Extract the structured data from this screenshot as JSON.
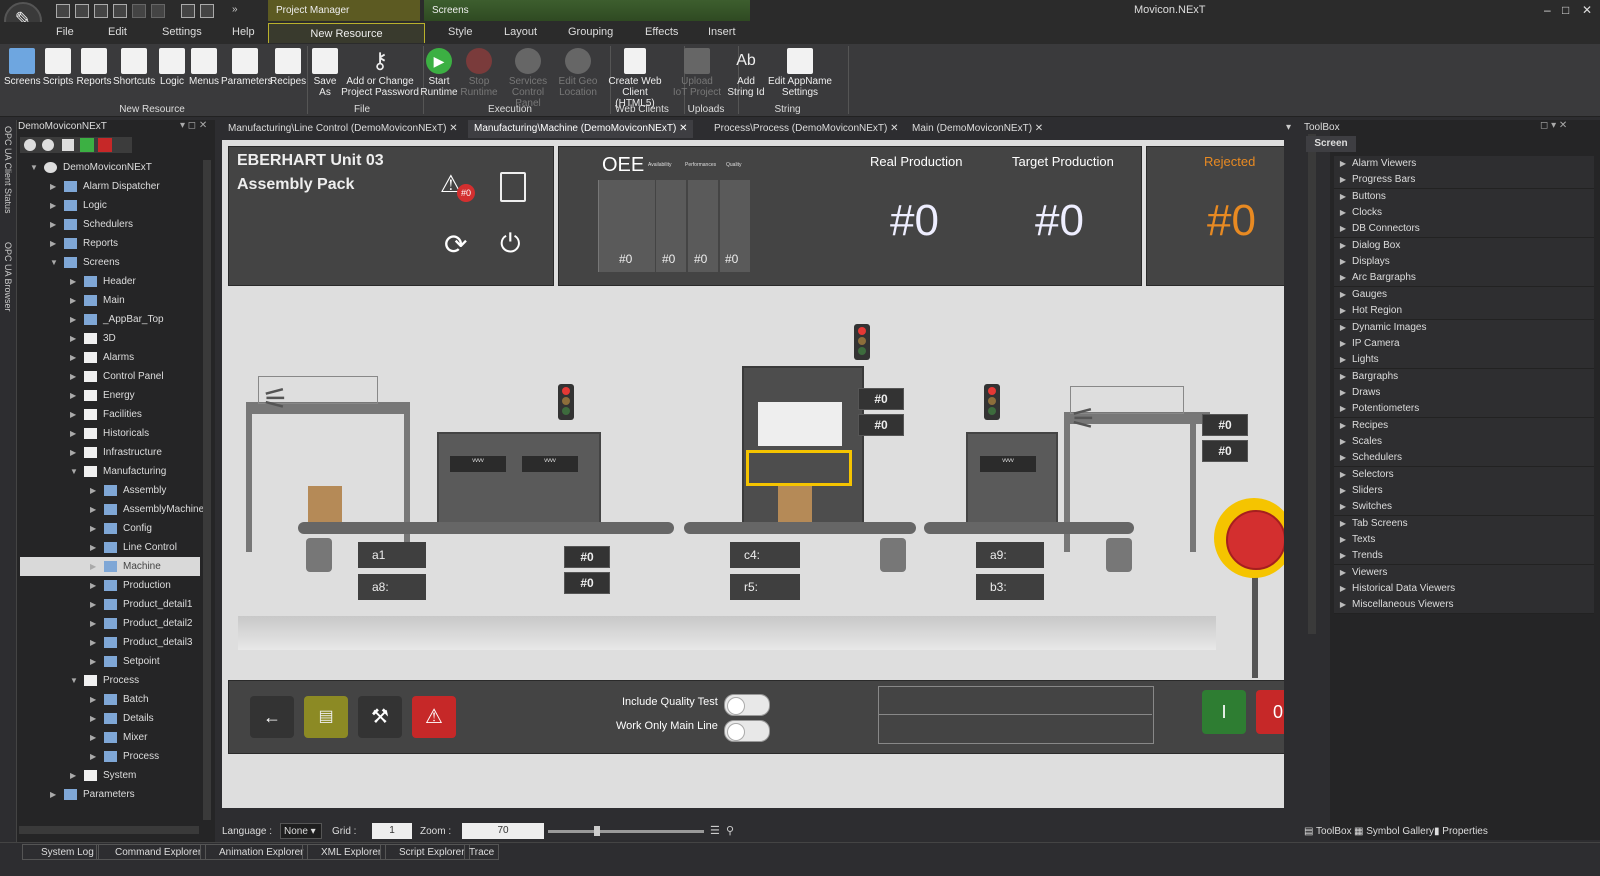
{
  "app": {
    "title": "Movicon.NExT",
    "ctx_project": "Project Manager",
    "ctx_screens": "Screens",
    "win_min": "–",
    "win_max": "□",
    "win_close": "✕"
  },
  "menu": {
    "file": "File",
    "edit": "Edit",
    "settings": "Settings",
    "help": "Help",
    "new_resource": "New Resource",
    "style": "Style",
    "layout": "Layout",
    "grouping": "Grouping",
    "effects": "Effects",
    "insert": "Insert"
  },
  "ribbon": {
    "screens": "Screens",
    "scripts": "Scripts",
    "reports": "Reports",
    "shortcuts": "Shortcuts",
    "logic": "Logic",
    "menus": "Menus",
    "parameters": "Parameters",
    "recipes": "Recipes",
    "save_as_1": "Save",
    "save_as_2": "As",
    "pwd_1": "Add or Change",
    "pwd_2": "Project Password",
    "start_1": "Start",
    "start_2": "Runtime",
    "stop_1": "Stop",
    "stop_2": "Runtime",
    "svc_1": "Services",
    "svc_2": "Control Panel",
    "geo_1": "Edit Geo",
    "geo_2": "Location",
    "web_1": "Create Web",
    "web_2": "Client (HTML5)",
    "upload_1": "Upload",
    "upload_2": "IoT Project",
    "addstr_1": "Add",
    "addstr_2": "String Id",
    "appname_1": "Edit AppName",
    "appname_2": "Settings",
    "g_newres": "New Resource",
    "g_file": "File",
    "g_exec": "Execution",
    "g_web": "Web Clients",
    "g_uploads": "Uploads",
    "g_string": "String"
  },
  "left": {
    "title": "DemoMoviconNExT",
    "strip1": "OPC UA Client Status",
    "strip2": "OPC UA Browser"
  },
  "tree": [
    {
      "label": "DemoMoviconNExT",
      "indent": 0,
      "icon": "gear",
      "arrow": "▼"
    },
    {
      "label": "Alarm Dispatcher",
      "indent": 1,
      "icon": "file",
      "arrow": "▶"
    },
    {
      "label": "Logic",
      "indent": 1,
      "icon": "file",
      "arrow": "▶"
    },
    {
      "label": "Schedulers",
      "indent": 1,
      "icon": "file",
      "arrow": "▶"
    },
    {
      "label": "Reports",
      "indent": 1,
      "icon": "file",
      "arrow": "▶"
    },
    {
      "label": "Screens",
      "indent": 1,
      "icon": "file",
      "arrow": "▼"
    },
    {
      "label": "Header",
      "indent": 2,
      "icon": "file",
      "arrow": "▶"
    },
    {
      "label": "Main",
      "indent": 2,
      "icon": "file",
      "arrow": "▶"
    },
    {
      "label": "_AppBar_Top",
      "indent": 2,
      "icon": "file",
      "arrow": "▶"
    },
    {
      "label": "3D",
      "indent": 2,
      "icon": "folder",
      "arrow": "▶"
    },
    {
      "label": "Alarms",
      "indent": 2,
      "icon": "folder",
      "arrow": "▶"
    },
    {
      "label": "Control Panel",
      "indent": 2,
      "icon": "folder",
      "arrow": "▶"
    },
    {
      "label": "Energy",
      "indent": 2,
      "icon": "folder",
      "arrow": "▶"
    },
    {
      "label": "Facilities",
      "indent": 2,
      "icon": "folder",
      "arrow": "▶"
    },
    {
      "label": "Historicals",
      "indent": 2,
      "icon": "folder",
      "arrow": "▶"
    },
    {
      "label": "Infrastructure",
      "indent": 2,
      "icon": "folder",
      "arrow": "▶"
    },
    {
      "label": "Manufacturing",
      "indent": 2,
      "icon": "folder",
      "arrow": "▼"
    },
    {
      "label": "Assembly",
      "indent": 3,
      "icon": "file",
      "arrow": "▶"
    },
    {
      "label": "AssemblyMachine",
      "indent": 3,
      "icon": "file",
      "arrow": "▶"
    },
    {
      "label": "Config",
      "indent": 3,
      "icon": "file",
      "arrow": "▶"
    },
    {
      "label": "Line Control",
      "indent": 3,
      "icon": "file",
      "arrow": "▶"
    },
    {
      "label": "Machine",
      "indent": 3,
      "icon": "file",
      "arrow": "▶",
      "selected": true
    },
    {
      "label": "Production",
      "indent": 3,
      "icon": "file",
      "arrow": "▶"
    },
    {
      "label": "Product_detail1",
      "indent": 3,
      "icon": "file",
      "arrow": "▶"
    },
    {
      "label": "Product_detail2",
      "indent": 3,
      "icon": "file",
      "arrow": "▶"
    },
    {
      "label": "Product_detail3",
      "indent": 3,
      "icon": "file",
      "arrow": "▶"
    },
    {
      "label": "Setpoint",
      "indent": 3,
      "icon": "file",
      "arrow": "▶"
    },
    {
      "label": "Process",
      "indent": 2,
      "icon": "folder",
      "arrow": "▼"
    },
    {
      "label": "Batch",
      "indent": 3,
      "icon": "file",
      "arrow": "▶"
    },
    {
      "label": "Details",
      "indent": 3,
      "icon": "file",
      "arrow": "▶"
    },
    {
      "label": "Mixer",
      "indent": 3,
      "icon": "file",
      "arrow": "▶"
    },
    {
      "label": "Process",
      "indent": 3,
      "icon": "file",
      "arrow": "▶"
    },
    {
      "label": "System",
      "indent": 2,
      "icon": "folder",
      "arrow": "▶"
    },
    {
      "label": "Parameters",
      "indent": 1,
      "icon": "file",
      "arrow": "▶"
    }
  ],
  "tabs": [
    "Manufacturing\\Line Control (DemoMoviconNExT)",
    "Manufacturing\\Machine (DemoMoviconNExT)",
    "Process\\Process (DemoMoviconNExT)",
    "Main (DemoMoviconNExT)"
  ],
  "screen": {
    "title1": "EBERHART  Unit 03",
    "title2": "Assembly Pack",
    "alarm_badge": "#0",
    "oee": "OEE",
    "oee_avail": "Availability",
    "oee_perf": "Performances",
    "oee_qual": "Quality",
    "oee_vals": [
      "#0",
      "#0",
      "#0",
      "#0"
    ],
    "real_prod": "Real Production",
    "target_prod": "Target Production",
    "rejected": "Rejected",
    "real_val": "#0",
    "target_val": "#0",
    "rejected_val": "#0",
    "tags": [
      "#0",
      "#0",
      "#0",
      "#0",
      "#0",
      "#0",
      "#0",
      "#0"
    ],
    "a1": "a1",
    "a8": "a8:",
    "c4": "c4:",
    "r5": "r5:",
    "a9": "a9:",
    "b3": "b3:",
    "quality_test": "Include Quality Test",
    "main_line": "Work Only Main Line",
    "start": "I",
    "stop": "0",
    "rejected_color": "#e88a22"
  },
  "status": {
    "language": "Language :",
    "language_val": "None",
    "grid": "Grid :",
    "grid_val": "1",
    "zoom": "Zoom :",
    "zoom_val": "70"
  },
  "bottom": [
    "System Log",
    "Command Explorer",
    "Animation Explorer",
    "XML Explorer",
    "Script Explorer",
    "Trace"
  ],
  "toolbox": {
    "title": "ToolBox",
    "tab": "Screen",
    "items": [
      "Alarm Viewers",
      "Progress Bars",
      "Buttons",
      "Clocks",
      "DB Connectors",
      "Dialog Box",
      "Displays",
      "Arc Bargraphs",
      "Gauges",
      "Hot Region",
      "Dynamic Images",
      "IP Camera",
      "Lights",
      "Bargraphs",
      "Draws",
      "Potentiometers",
      "Recipes",
      "Scales",
      "Schedulers",
      "Selectors",
      "Sliders",
      "Switches",
      "Tab Screens",
      "Texts",
      "Trends",
      "Viewers",
      "Historical Data Viewers",
      "Miscellaneous Viewers"
    ],
    "foot_toolbox": "ToolBox",
    "foot_symbols": "Symbol Gallery",
    "foot_props": "Properties"
  }
}
